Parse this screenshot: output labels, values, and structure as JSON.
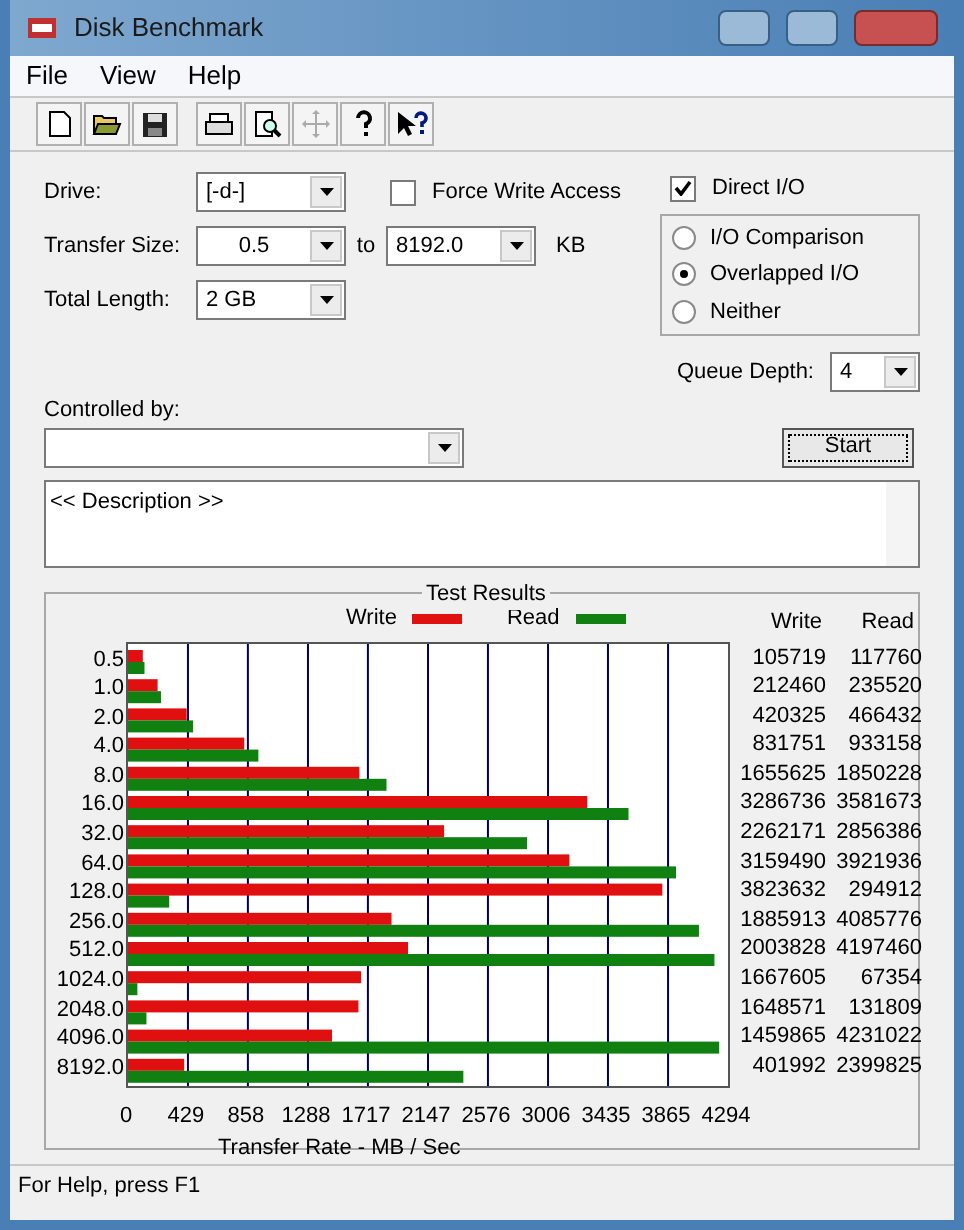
{
  "window": {
    "title": "Disk Benchmark"
  },
  "menu": [
    "File",
    "View",
    "Help"
  ],
  "form": {
    "drive_label": "Drive:",
    "drive": "[-d-]",
    "force_write": {
      "label": "Force Write Access",
      "checked": false
    },
    "transfer_label": "Transfer Size:",
    "transfer_from": "0.5",
    "to_label": "to",
    "transfer_to": "8192.0",
    "unit": "KB",
    "length_label": "Total Length:",
    "length": "2 GB",
    "direct_io": {
      "label": "Direct I/O",
      "checked": true
    },
    "modes": [
      {
        "label": "I/O Comparison",
        "selected": false
      },
      {
        "label": "Overlapped I/O",
        "selected": true
      },
      {
        "label": "Neither",
        "selected": false
      }
    ],
    "queue_label": "Queue Depth:",
    "queue": "4",
    "controlled_label": "Controlled by:",
    "start": "Start",
    "description": "<< Description >>"
  },
  "results": {
    "title": "Test Results",
    "col_write": "Write",
    "col_read": "Read",
    "rows": [
      [
        "105719",
        "117760"
      ],
      [
        "212460",
        "235520"
      ],
      [
        "420325",
        "466432"
      ],
      [
        "831751",
        "933158"
      ],
      [
        "1655625",
        "1850228"
      ],
      [
        "3286736",
        "3581673"
      ],
      [
        "2262171",
        "2856386"
      ],
      [
        "3159490",
        "3921936"
      ],
      [
        "3823632",
        "294912"
      ],
      [
        "1885913",
        "4085776"
      ],
      [
        "2003828",
        "4197460"
      ],
      [
        "1667605",
        "67354"
      ],
      [
        "1648571",
        "131809"
      ],
      [
        "1459865",
        "4231022"
      ],
      [
        "401992",
        "2399825"
      ]
    ],
    "chart_data": {
      "type": "bar",
      "orientation": "horizontal",
      "xlabel": "Transfer Rate - MB / Sec",
      "grid": true,
      "legend": "top",
      "categories": [
        "0.5",
        "1.0",
        "2.0",
        "4.0",
        "8.0",
        "16.0",
        "32.0",
        "64.0",
        "128.0",
        "256.0",
        "512.0",
        "1024.0",
        "2048.0",
        "4096.0",
        "8192.0"
      ],
      "series": [
        {
          "name": "Write",
          "color": "#e01010",
          "values": [
            106,
            212,
            420,
            832,
            1656,
            3287,
            2262,
            3159,
            3824,
            1886,
            2004,
            1668,
            1649,
            1460,
            402
          ]
        },
        {
          "name": "Read",
          "color": "#108010",
          "values": [
            118,
            236,
            466,
            933,
            1850,
            3582,
            2856,
            3922,
            295,
            4086,
            4197,
            67,
            132,
            4231,
            2400
          ]
        }
      ],
      "xlim": [
        0,
        4294
      ],
      "xticks": [
        0,
        429,
        858,
        1288,
        1717,
        2147,
        2576,
        3006,
        3435,
        3865,
        4294
      ]
    }
  },
  "status_bar": "For Help, press F1"
}
